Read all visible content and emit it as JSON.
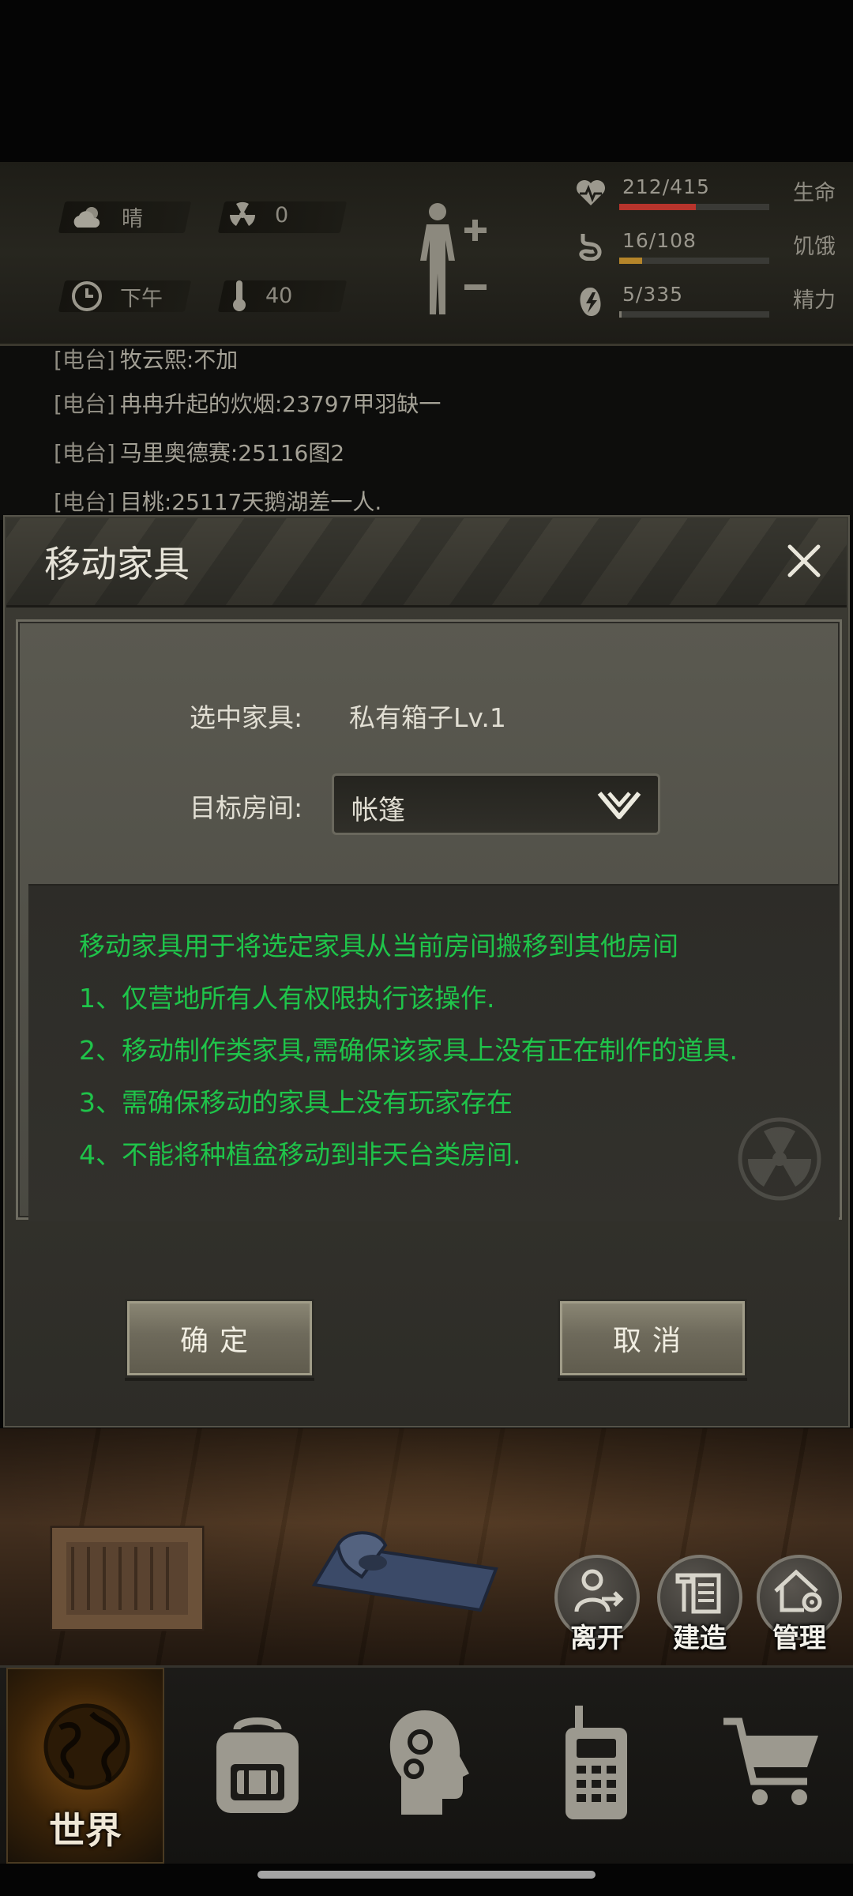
{
  "hud": {
    "weather": "晴",
    "radiation": "0",
    "time_of_day": "下午",
    "temperature": "40",
    "stats": [
      {
        "value": "212/415",
        "label": "生命",
        "fill": 0.51,
        "color": "#b8342c"
      },
      {
        "value": "16/108",
        "label": "饥饿",
        "fill": 0.15,
        "color": "#b5852a"
      },
      {
        "value": "5/335",
        "label": "精力",
        "fill": 0.015,
        "color": "#7d7a70"
      }
    ]
  },
  "chat": {
    "lines": [
      {
        "tag": "[电台]",
        "text": "牧云熙:不加"
      },
      {
        "tag": "[电台]",
        "text": "冉冉升起的炊烟:23797甲羽缺一"
      },
      {
        "tag": "[电台]",
        "text": "马里奥德赛:25116图2"
      },
      {
        "tag": "[电台]",
        "text": "目桃:25117天鹅湖差一人."
      }
    ]
  },
  "dialog": {
    "title": "移动家具",
    "selected_label": "选中家具:",
    "selected_value": "私有箱子Lv.1",
    "target_label": "目标房间:",
    "target_value": "帐篷",
    "info_lines": [
      "移动家具用于将选定家具从当前房间搬移到其他房间",
      "1、仅营地所有人有权限执行该操作.",
      "2、移动制作类家具,需确保该家具上没有正在制作的道具.",
      "3、需确保移动的家具上没有玩家存在",
      "4、不能将种植盆移动到非天台类房间."
    ],
    "confirm_label": "确定",
    "cancel_label": "取消"
  },
  "room": {
    "leave_label": "离开",
    "build_label": "建造",
    "manage_label": "管理"
  },
  "nav": {
    "world_label": "世界"
  }
}
